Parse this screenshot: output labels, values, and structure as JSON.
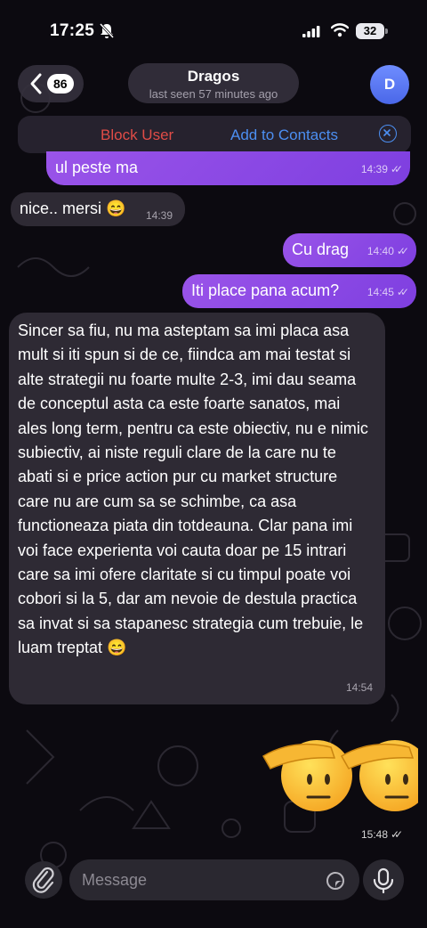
{
  "status_bar": {
    "time": "17:25",
    "battery": "32"
  },
  "header": {
    "back_count": "86",
    "contact_name": "Dragos",
    "last_seen": "last seen 57 minutes ago",
    "avatar_initial": "D"
  },
  "action_bar": {
    "block_label": "Block User",
    "add_label": "Add to Contacts"
  },
  "messages": [
    {
      "direction": "out",
      "text": "ul peste ma",
      "time": "14:39"
    },
    {
      "direction": "in",
      "text": "nice.. mersi 😄",
      "time": "14:39"
    },
    {
      "direction": "out",
      "text": "Cu drag",
      "time": "14:40"
    },
    {
      "direction": "out",
      "text": "Iti place pana acum?",
      "time": "14:45"
    },
    {
      "direction": "in",
      "text": "Sincer sa fiu, nu ma asteptam sa imi placa asa mult si iti spun si de ce, fiindca am mai testat si alte strategii nu foarte multe 2-3, imi dau seama de conceptul asta ca este foarte sanatos, mai ales long term, pentru ca este obiectiv, nu e nimic subiectiv, ai niste reguli clare de la care nu te abati si e price action pur cu market structure care nu are cum sa se schimbe, ca asa functioneaza piata din totdeauna. Clar pana imi voi face experienta voi cauta doar pe 15 intrari care sa imi ofere claritate si cu timpul poate voi cobori si la 5, dar am nevoie de destula practica sa invat si sa stapanesc strategia cum trebuie, le luam treptat 😄",
      "time": "14:54"
    },
    {
      "direction": "out",
      "sticker": "saluting-face-emoji x2",
      "time": "15:48"
    }
  ],
  "input": {
    "placeholder": "Message"
  },
  "colors": {
    "outgoing_bubble": "#8a4ae6",
    "incoming_bubble": "#2e2a34",
    "block": "#e04c47",
    "link": "#4c8ff2"
  }
}
